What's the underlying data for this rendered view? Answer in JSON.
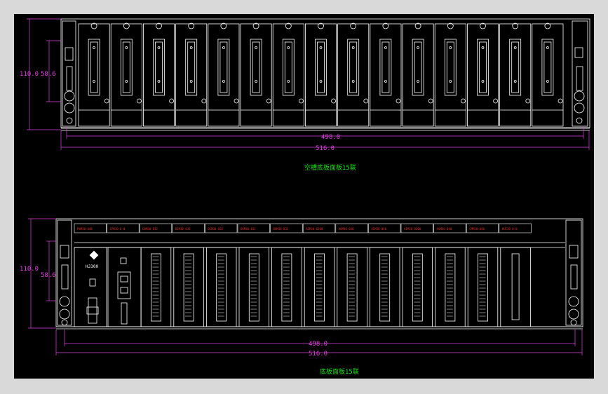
{
  "colors": {
    "background": "#000000",
    "outer_frame": "#d9d9d9",
    "outline": "#ffffff",
    "dimension": "#e040e0",
    "caption": "#10e010",
    "module_label": "#e03030"
  },
  "top_drawing": {
    "caption": "空槽底板面板15联",
    "dim_height_outer": "110.0",
    "dim_height_inner": "58.6",
    "dim_width_inner": "498.0",
    "dim_width_outer": "516.0"
  },
  "bottom_drawing": {
    "caption": "底板面板15联",
    "dim_height_outer": "110.0",
    "dim_height_inner": "58.6",
    "dim_width_inner": "498.0",
    "dim_width_outer": "516.0",
    "brand": "HJ300",
    "module_labels": [
      "PWM30-048",
      "CPU30-0-0",
      "DOM30-032",
      "DIM30-032",
      "DIM30-032",
      "DOM30-032",
      "DOM30-032",
      "AIM30-0200",
      "AOM30-040",
      "AIM30-040",
      "AIM30-0200",
      "AOM30-040",
      "CMM30-040",
      "HUI30-0-0"
    ]
  }
}
